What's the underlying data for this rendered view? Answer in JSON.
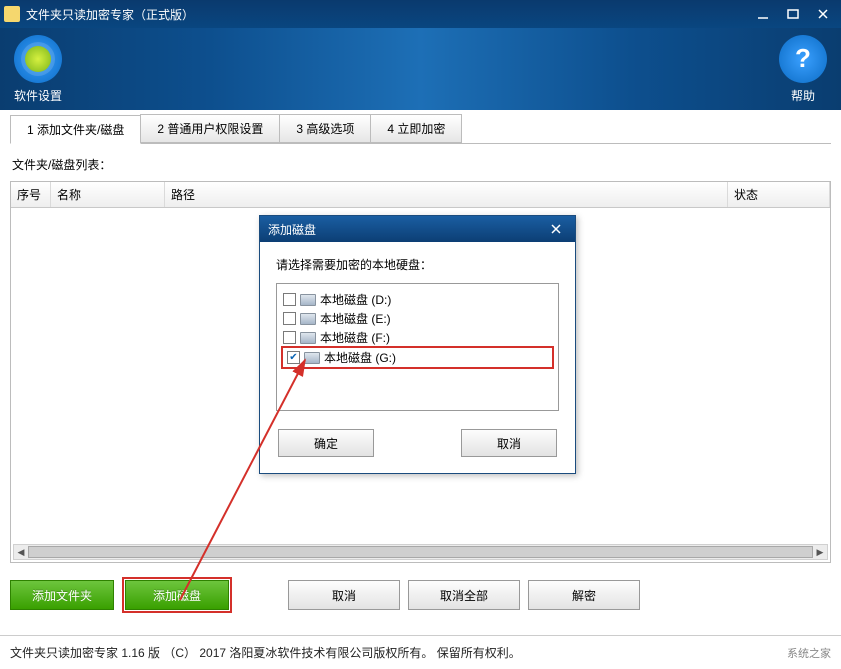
{
  "window": {
    "title": "文件夹只读加密专家（正式版）"
  },
  "header": {
    "settings_label": "软件设置",
    "help_label": "帮助",
    "help_glyph": "?"
  },
  "tabs": [
    {
      "label": "1 添加文件夹/磁盘",
      "active": true
    },
    {
      "label": "2 普通用户权限设置",
      "active": false
    },
    {
      "label": "3 高级选项",
      "active": false
    },
    {
      "label": "4 立即加密",
      "active": false
    }
  ],
  "list_label": "文件夹/磁盘列表：",
  "columns": {
    "c1": "序号",
    "c2": "名称",
    "c3": "路径",
    "c4": "状态"
  },
  "action_buttons": {
    "add_folder": "添加文件夹",
    "add_disk": "添加磁盘",
    "cancel": "取消",
    "cancel_all": "取消全部",
    "decrypt": "解密"
  },
  "footer": {
    "text": "文件夹只读加密专家 1.16 版 （C） 2017 洛阳夏冰软件技术有限公司版权所有。 保留所有权利。",
    "brand": "系统之家"
  },
  "modal": {
    "title": "添加磁盘",
    "prompt": "请选择需要加密的本地硬盘：",
    "disks": [
      {
        "label": "本地磁盘 (D:)",
        "checked": false,
        "hl": false
      },
      {
        "label": "本地磁盘 (E:)",
        "checked": false,
        "hl": false
      },
      {
        "label": "本地磁盘 (F:)",
        "checked": false,
        "hl": false
      },
      {
        "label": "本地磁盘 (G:)",
        "checked": true,
        "hl": true
      }
    ],
    "ok": "确定",
    "cancel": "取消"
  }
}
